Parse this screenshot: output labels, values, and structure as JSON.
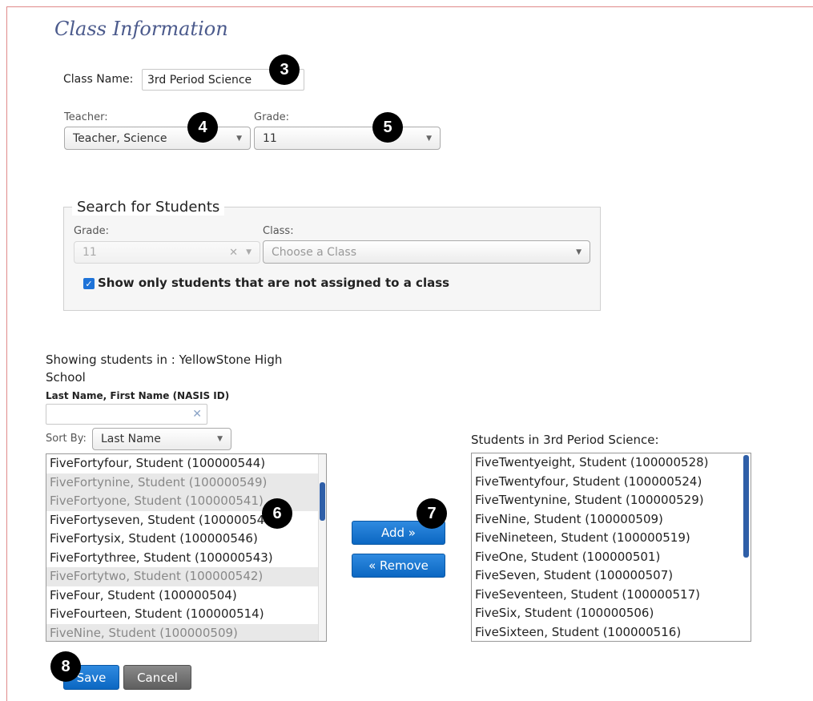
{
  "page": {
    "title": "Class Information"
  },
  "class_name": {
    "label": "Class Name:",
    "value": "3rd Period Science"
  },
  "teacher": {
    "label": "Teacher:",
    "value": "Teacher, Science"
  },
  "grade": {
    "label": "Grade:",
    "value": "11"
  },
  "search": {
    "legend": "Search for Students",
    "grade_label": "Grade:",
    "grade_value": "11",
    "clear_symbol": "✕",
    "class_label": "Class:",
    "class_placeholder": "Choose a Class",
    "checkbox_label": "Show only students that are not assigned to a class",
    "checkbox_checked": true
  },
  "available": {
    "showing_label_line1": "Showing students in : YellowStone High",
    "showing_label_line2": "School",
    "filter_label": "Last Name, First Name (NASIS ID)",
    "filter_value": "",
    "filter_clear": "✕",
    "sort_label": "Sort By:",
    "sort_value": "Last Name",
    "students": [
      {
        "name": "FiveFortyfour, Student (100000544)",
        "selected": false
      },
      {
        "name": "FiveFortynine, Student (100000549)",
        "selected": true
      },
      {
        "name": "FiveFortyone, Student (100000541)",
        "selected": true
      },
      {
        "name": "FiveFortyseven, Student (100000547)",
        "selected": false
      },
      {
        "name": "FiveFortysix, Student (100000546)",
        "selected": false
      },
      {
        "name": "FiveFortythree, Student (100000543)",
        "selected": false
      },
      {
        "name": "FiveFortytwo, Student (100000542)",
        "selected": true
      },
      {
        "name": "FiveFour, Student (100000504)",
        "selected": false
      },
      {
        "name": "FiveFourteen, Student (100000514)",
        "selected": false
      },
      {
        "name": "FiveNine, Student (100000509)",
        "selected": true
      }
    ]
  },
  "actions": {
    "add_label": "Add »",
    "remove_label": "« Remove"
  },
  "assigned": {
    "label": "Students in 3rd Period Science:",
    "students": [
      "FiveTwentyeight, Student (100000528)",
      "FiveTwentyfour, Student (100000524)",
      "FiveTwentynine, Student (100000529)",
      "FiveNine, Student (100000509)",
      "FiveNineteen, Student (100000519)",
      "FiveOne, Student (100000501)",
      "FiveSeven, Student (100000507)",
      "FiveSeventeen, Student (100000517)",
      "FiveSix, Student (100000506)",
      "FiveSixteen, Student (100000516)"
    ]
  },
  "footer": {
    "save_label": "Save",
    "cancel_label": "Cancel"
  },
  "callouts": [
    "3",
    "4",
    "5",
    "6",
    "7",
    "8"
  ],
  "colors": {
    "accent_blue": "#0b67c2",
    "title": "#4b5a8c",
    "scroll_thumb": "#2f5fa8"
  }
}
